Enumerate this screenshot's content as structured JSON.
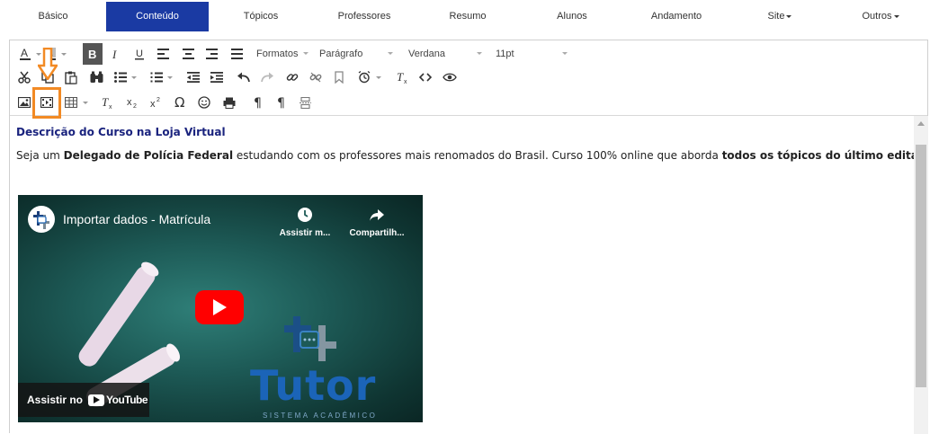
{
  "nav": {
    "tabs": [
      {
        "label": "Básico"
      },
      {
        "label": "Conteúdo",
        "active": true
      },
      {
        "label": "Tópicos"
      },
      {
        "label": "Professores"
      },
      {
        "label": "Resumo"
      },
      {
        "label": "Alunos"
      },
      {
        "label": "Andamento"
      },
      {
        "label": "Site",
        "dropdown": true
      },
      {
        "label": "Outros",
        "dropdown": true
      }
    ]
  },
  "toolbar": {
    "formats_label": "Formatos",
    "block_label": "Parágrafo",
    "font_family": "Verdana",
    "font_size": "11pt"
  },
  "content": {
    "heading": "Descrição do Curso na Loja Virtual",
    "para_1": "Seja um ",
    "para_bold_1": "Delegado de Polícia Federal",
    "para_2": " estudando com os professores mais renomados do Brasil. Curso 100% online que aborda ",
    "para_bold_2": "todos os tópicos do último edital",
    "para_3": "."
  },
  "video": {
    "title": "Importar dados - Matrícula",
    "watch_later": "Assistir m...",
    "share": "Compartilh...",
    "watch_on": "Assistir no",
    "youtube": "YouTube",
    "brand": "Tutor",
    "brand_sub": "SISTEMA ACADÊMICO"
  },
  "colors": {
    "active_tab": "#1a3aa3",
    "highlight": "#f28a24",
    "heading": "#1a237e",
    "youtube_red": "#ff0000"
  }
}
